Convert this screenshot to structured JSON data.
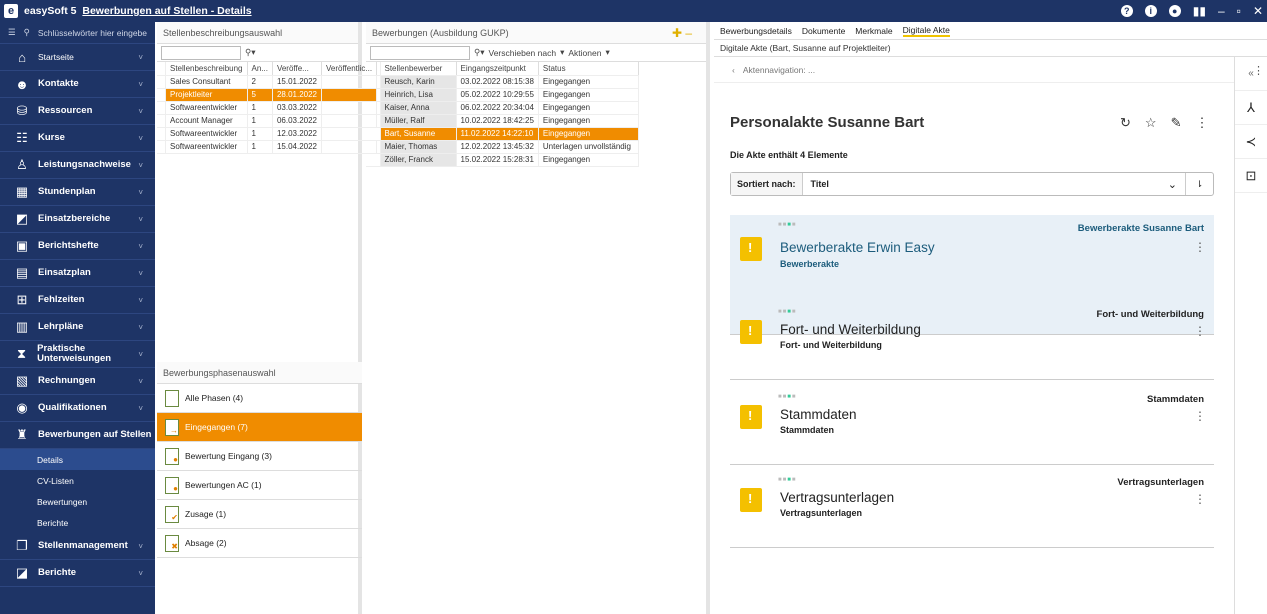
{
  "app": {
    "logo": "e",
    "title": "easySoft 5",
    "page": "Bewerbungen auf Stellen - Details"
  },
  "titlebar_icons": [
    "?",
    "i",
    "record-icon",
    "signal-icon",
    "–",
    "restore-icon",
    "close-icon"
  ],
  "sidebar": {
    "search_placeholder": "Schlüsselwörter hier eingebe",
    "items": [
      {
        "label": "Startseite",
        "icon": "home-icon",
        "small": true
      },
      {
        "label": "Kontakte",
        "icon": "person-icon"
      },
      {
        "label": "Ressourcen",
        "icon": "resource-icon"
      },
      {
        "label": "Kurse",
        "icon": "courses-icon"
      },
      {
        "label": "Leistungsnachweise",
        "icon": "badge-icon"
      },
      {
        "label": "Stundenplan",
        "icon": "calendar-icon"
      },
      {
        "label": "Einsatzbereiche",
        "icon": "areas-icon"
      },
      {
        "label": "Berichtshefte",
        "icon": "report-book-icon"
      },
      {
        "label": "Einsatzplan",
        "icon": "plan-icon"
      },
      {
        "label": "Fehlzeiten",
        "icon": "absence-icon"
      },
      {
        "label": "Lehrpläne",
        "icon": "curriculum-icon"
      },
      {
        "label": "Praktische Unterweisungen",
        "icon": "instruction-icon"
      },
      {
        "label": "Rechnungen",
        "icon": "invoice-icon"
      },
      {
        "label": "Qualifikationen",
        "icon": "qualification-icon"
      },
      {
        "label": "Bewerbungen auf Stellen",
        "icon": "application-icon",
        "expanded": true
      }
    ],
    "subitems": [
      "Details",
      "CV-Listen",
      "Bewertungen",
      "Berichte"
    ],
    "items_after": [
      {
        "label": "Stellenmanagement",
        "icon": "jobs-icon"
      },
      {
        "label": "Berichte",
        "icon": "chart-icon"
      }
    ]
  },
  "p1": {
    "title": "Stellenbeschreibungsauswahl",
    "columns": [
      "Stellenbeschreibung",
      "An...",
      "Veröffe...",
      "Veröffentlic..."
    ],
    "rows": [
      [
        "Sales Consultant",
        "2",
        "15.01.2022",
        ""
      ],
      [
        "Projektleiter",
        "5",
        "28.01.2022",
        ""
      ],
      [
        "Softwareentwickler",
        "1",
        "03.03.2022",
        ""
      ],
      [
        "Account Manager",
        "1",
        "06.03.2022",
        ""
      ],
      [
        "Softwareentwickler",
        "1",
        "12.03.2022",
        ""
      ],
      [
        "Softwareentwickler",
        "1",
        "15.04.2022",
        ""
      ]
    ],
    "selected": 1,
    "phase_title": "Bewerbungsphasenauswahl",
    "phases": [
      "Alle Phasen (4)",
      "Eingegangen (7)",
      "Bewertung Eingang (3)",
      "Bewertungen AC (1)",
      "Zusage (1)",
      "Absage (2)"
    ],
    "phase_selected": 1
  },
  "p2": {
    "title": "Bewerbungen (Ausbildung GUKP)",
    "move_label": "Verschieben nach",
    "actions_label": "Aktionen",
    "columns": [
      "Stellenbewerber",
      "Eingangszeitpunkt",
      "Status"
    ],
    "rows": [
      [
        "Reusch, Karin",
        "03.02.2022 08:15:38",
        "Eingegangen"
      ],
      [
        "Heinrich, Lisa",
        "05.02.2022 10:29:55",
        "Eingegangen"
      ],
      [
        "Kaiser, Anna",
        "06.02.2022 20:34:04",
        "Eingegangen"
      ],
      [
        "Müller, Ralf",
        "10.02.2022 18:42:25",
        "Eingegangen"
      ],
      [
        "Bart, Susanne",
        "11.02.2022 14:22:10",
        "Eingegangen"
      ],
      [
        "Maier, Thomas",
        "12.02.2022 13:45:32",
        "Unterlagen unvollständig"
      ],
      [
        "Zöller, Franck",
        "15.02.2022 15:28:31",
        "Eingegangen"
      ]
    ],
    "selected": 4
  },
  "p3": {
    "tabs": [
      "Bewerbungsdetails",
      "Dokumente",
      "Merkmale",
      "Digitale Akte"
    ],
    "active_tab": 3,
    "crumb": "Digitale Akte (Bart, Susanne auf Projektleiter)",
    "nav_label": "Aktennavigation: ...",
    "heading": "Personalakte Susanne Bart",
    "count_text": "Die Akte enthält 4 Elemente",
    "sort_label": "Sortiert nach:",
    "sort_value": "Titel",
    "cards": [
      {
        "top_right": "Bewerberakte Susanne Bart",
        "title": "Bewerberakte Erwin Easy",
        "subtitle": "Bewerberakte",
        "highlight": true
      },
      {
        "top_right": "Fort- und Weiterbildung",
        "title": "Fort- und Weiterbildung",
        "subtitle": "Fort- und Weiterbildung"
      },
      {
        "top_right": "Stammdaten",
        "title": "Stammdaten",
        "subtitle": "Stammdaten"
      },
      {
        "top_right": "Vertragsunterlagen",
        "title": "Vertragsunterlagen",
        "subtitle": "Vertragsunterlagen"
      }
    ]
  },
  "colors": {
    "navy": "#1e3466",
    "orange": "#f08c00",
    "teal": "#1c5c7c",
    "card_highlight": "#e8f0f7"
  }
}
